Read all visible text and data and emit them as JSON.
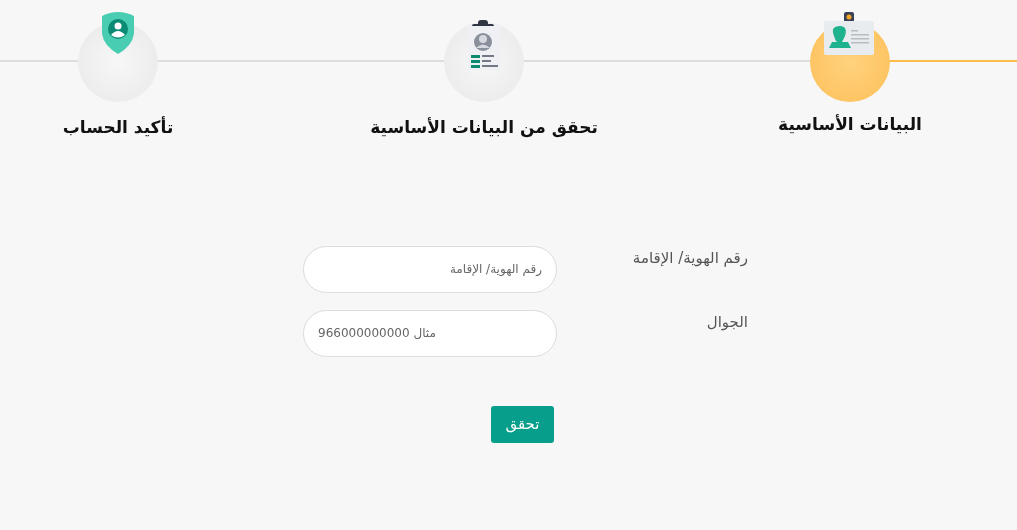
{
  "steps": [
    {
      "label": "البيانات الأساسية",
      "active": true,
      "kind": "id-card"
    },
    {
      "label": "تحقق من البيانات الأساسية",
      "active": false,
      "kind": "badge"
    },
    {
      "label": "تأكيد الحساب",
      "active": false,
      "kind": "shield"
    }
  ],
  "form": {
    "fields": [
      {
        "label": "رقم الهوية/ الإقامة",
        "placeholder": "رقم الهوية/ الإقامة",
        "kind": "text"
      },
      {
        "label": "الجوال",
        "placeholder": "مثال 966000000000",
        "kind": "phone"
      }
    ],
    "submit": "تحقق"
  }
}
